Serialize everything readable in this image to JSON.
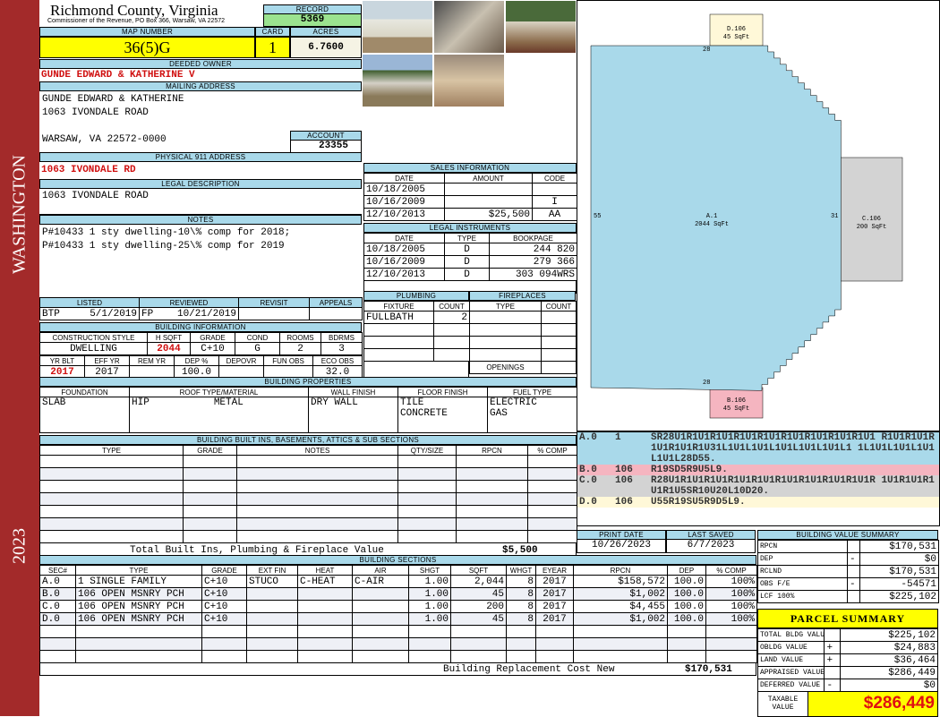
{
  "sidebar": {
    "district": "WASHINGTON",
    "year": "2023"
  },
  "header": {
    "county": "Richmond County, Virginia",
    "office": "Commissioner of the Revenue, PO Box 366, Warsaw, VA 22572",
    "record_label": "RECORD",
    "record": "5369"
  },
  "parcel": {
    "map_label": "MAP NUMBER",
    "map_number": "36(5)G",
    "card_label": "CARD",
    "card": "1",
    "acres_label": "ACRES",
    "acres": "6.7600"
  },
  "owner": {
    "label": "DEEDED OWNER",
    "name": "GUNDE EDWARD & KATHERINE V"
  },
  "mailing": {
    "label": "MAILING ADDRESS",
    "line1": "GUNDE EDWARD & KATHERINE",
    "line2": "1063 IVONDALE ROAD",
    "line3": "WARSAW, VA 22572-0000"
  },
  "account": {
    "label": "ACCOUNT",
    "value": "23355"
  },
  "physical": {
    "label": "PHYSICAL 911 ADDRESS",
    "value": "1063 IVONDALE RD"
  },
  "legal": {
    "label": "LEGAL DESCRIPTION",
    "value": "1063 IVONDALE ROAD"
  },
  "notes": {
    "label": "NOTES",
    "value": "P#10433 1 sty dwelling-10\\% comp for 2018; P#10433 1 sty dwelling-25\\% comp for 2019"
  },
  "review": {
    "headers": [
      "LISTED",
      "REVIEWED",
      "REVISIT",
      "APPEALS"
    ],
    "listed_by": "BTP",
    "listed": "5/1/2019",
    "reviewed_by": "FP",
    "reviewed": "10/21/2019"
  },
  "building_info": {
    "label": "BUILDING INFORMATION",
    "headers1": [
      "CONSTRUCTION STYLE",
      "H SQFT",
      "GRADE",
      "COND",
      "ROOMS",
      "BDRMS"
    ],
    "values1": [
      "DWELLING",
      "2044",
      "C+10",
      "G",
      "2",
      "3"
    ],
    "headers2": [
      "YR BLT",
      "EFF YR",
      "REM YR",
      "DEP %",
      "DEPOVR",
      "FUN OBS",
      "ECO OBS"
    ],
    "values2": [
      "2017",
      "2017",
      "",
      "100.0",
      "",
      "",
      "32.0"
    ]
  },
  "sales": {
    "label": "SALES INFORMATION",
    "headers": [
      "DATE",
      "AMOUNT",
      "CODE"
    ],
    "rows": [
      [
        "10/18/2005",
        "",
        ""
      ],
      [
        "10/16/2009",
        "",
        "I"
      ],
      [
        "12/10/2013",
        "$25,500",
        "AA"
      ]
    ]
  },
  "instruments": {
    "label": "LEGAL INSTRUMENTS",
    "headers": [
      "DATE",
      "TYPE",
      "BOOKPAGE"
    ],
    "rows": [
      [
        "10/18/2005",
        "D",
        "244 820"
      ],
      [
        "10/16/2009",
        "D",
        "279 366"
      ],
      [
        "12/10/2013",
        "D",
        "303 094WRS"
      ]
    ]
  },
  "plumbing": {
    "label": "PLUMBING",
    "headers": [
      "FIXTURE",
      "COUNT"
    ],
    "rows": [
      [
        "FULLBATH",
        "2"
      ],
      [
        "",
        ""
      ],
      [
        "",
        ""
      ],
      [
        "",
        ""
      ]
    ]
  },
  "fireplaces": {
    "label": "FIREPLACES",
    "headers": [
      "TYPE",
      "COUNT"
    ],
    "openings": "OPENINGS"
  },
  "properties": {
    "label": "BUILDING PROPERTIES",
    "headers": [
      "FOUNDATION",
      "ROOF TYPE/MATERIAL",
      "WALL FINISH",
      "FLOOR FINISH",
      "FUEL TYPE"
    ],
    "foundation": "SLAB",
    "roof_type": "HIP",
    "roof_material": "METAL",
    "wall": "DRY WALL",
    "floor1": "TILE",
    "floor2": "CONCRETE",
    "fuel1": "ELECTRIC",
    "fuel2": "GAS"
  },
  "builtins": {
    "label": "BUILDING BUILT INS, BASEMENTS, ATTICS & SUB SECTIONS",
    "headers": [
      "TYPE",
      "GRADE",
      "NOTES",
      "QTY/SIZE",
      "RPCN",
      "% COMP"
    ],
    "total_label": "Total Built Ins, Plumbing & Fireplace Value",
    "total": "$5,500"
  },
  "sections": {
    "label": "BUILDING SECTIONS",
    "headers": [
      "SEC#",
      "TYPE",
      "GRADE",
      "EXT FIN",
      "HEAT",
      "AIR",
      "SHGT",
      "SQFT",
      "WHGT",
      "EYEAR",
      "RPCN",
      "DEP",
      "% COMP"
    ],
    "rows": [
      [
        "A.0",
        "1 SINGLE FAMILY",
        "C+10",
        "STUCO",
        "C-HEAT",
        "C-AIR",
        "1.00",
        "2,044",
        "8",
        "2017",
        "$158,572",
        "100.0",
        "100%"
      ],
      [
        "B.0",
        "106 OPEN MSNRY PCH",
        "C+10",
        "",
        "",
        "",
        "1.00",
        "45",
        "8",
        "2017",
        "$1,002",
        "100.0",
        "100%"
      ],
      [
        "C.0",
        "106 OPEN MSNRY PCH",
        "C+10",
        "",
        "",
        "",
        "1.00",
        "200",
        "8",
        "2017",
        "$4,455",
        "100.0",
        "100%"
      ],
      [
        "D.0",
        "106 OPEN MSNRY PCH",
        "C+10",
        "",
        "",
        "",
        "1.00",
        "45",
        "8",
        "2017",
        "$1,002",
        "100.0",
        "100%"
      ]
    ],
    "cost_label": "Building Replacement Cost New",
    "cost": "$170,531"
  },
  "sketch": {
    "a_label": "A.1",
    "a_area": "2044 SqFt",
    "b_label": "B.106",
    "b_area": "45 SqFt",
    "c_label": "C.106",
    "c_area": "200 SqFt",
    "d_label": "D.106",
    "d_area": "45 SqFt",
    "dim_top": "28",
    "dim_bottom": "28",
    "dim_left": "55",
    "dim_right": "31",
    "step": "1"
  },
  "legend": [
    {
      "sec": "A.0",
      "code": "1",
      "path": "SR28U1R1U1R1U1R1U1R1U1R1U1R1U1R1U1R1U1 R1U1R1U1R1U1R1U1R1U31L1U1L1U1L1U1L1U1L1U1L1 1L1U1L1U1L1U1L1U1L28D55.",
      "color": "#a9d9ea"
    },
    {
      "sec": "B.0",
      "code": "106",
      "path": "R19SD5R9U5L9.",
      "color": "#f5b5c0"
    },
    {
      "sec": "C.0",
      "code": "106",
      "path": "R28U1R1U1R1U1R1U1R1U1R1U1R1U1R1U1R1U1R 1U1R1U1R1U1R1U5SR10U20L10D20.",
      "color": "#d3d3d3"
    },
    {
      "sec": "D.0",
      "code": "106",
      "path": "U55R19SU5R9D5L9.",
      "color": "#fff8d8"
    }
  ],
  "dates": {
    "print_label": "PRINT DATE",
    "print": "10/26/2023",
    "saved_label": "LAST SAVED",
    "saved": "6/7/2023"
  },
  "value_summary": {
    "label": "BUILDING VALUE SUMMARY",
    "rows": [
      [
        "RPCN",
        "",
        "$170,531"
      ],
      [
        "DEP",
        "-",
        "$0"
      ],
      [
        "RCLND",
        "",
        "$170,531"
      ],
      [
        "OBS F/E",
        "-",
        "-54571"
      ],
      [
        "LCF 100%",
        "",
        "$225,102"
      ]
    ]
  },
  "parcel_summary": {
    "label": "PARCEL SUMMARY",
    "rows": [
      [
        "TOTAL BLDG VALUE",
        "",
        "$225,102"
      ],
      [
        "OBLDG VALUE",
        "+",
        "$24,883"
      ],
      [
        "LAND VALUE",
        "+",
        "$36,464"
      ],
      [
        "APPRAISED VALUE",
        "",
        "$286,449"
      ],
      [
        "DEFERRED VALUE",
        "-",
        "$0"
      ]
    ],
    "taxable_label": "TAXABLE VALUE",
    "taxable": "$286,449"
  }
}
